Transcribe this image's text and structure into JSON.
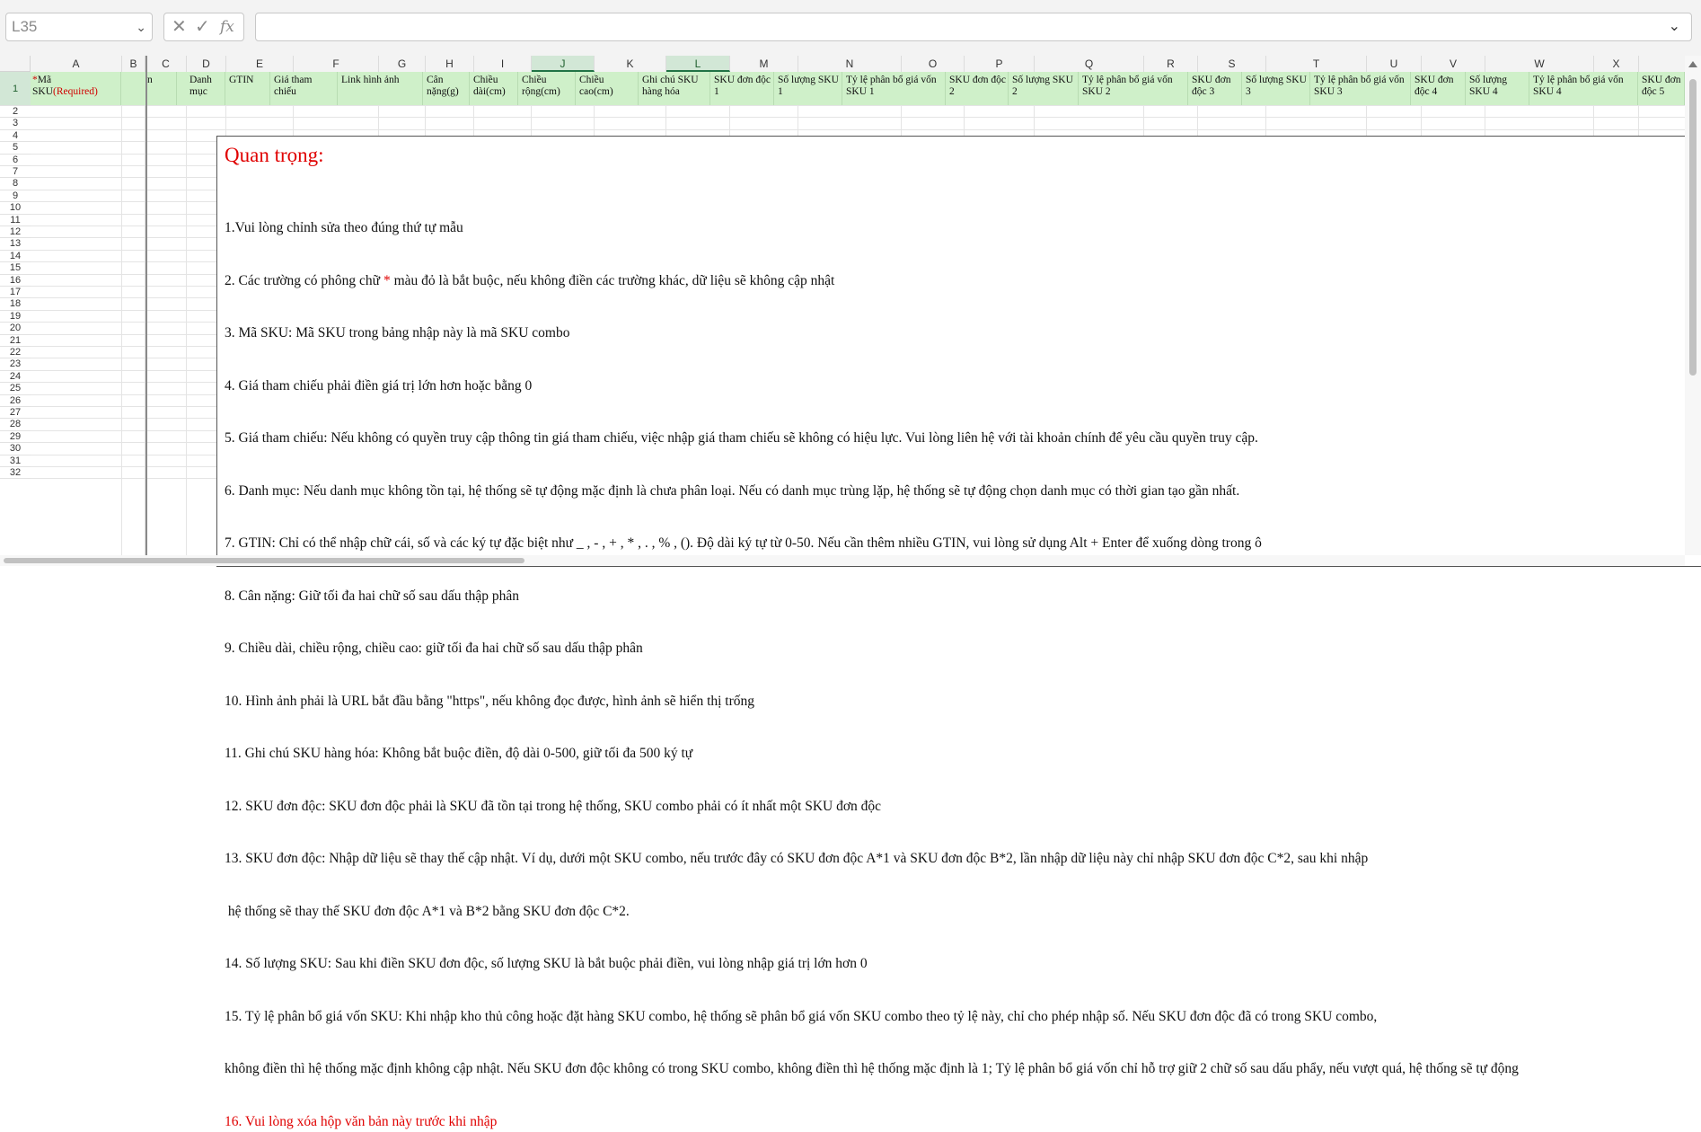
{
  "formula_bar": {
    "name_box": "L35",
    "cancel_glyph": "✕",
    "confirm_glyph": "✓",
    "fx_label": "fx",
    "formula_value": ""
  },
  "columns": [
    "A",
    "B",
    "C",
    "D",
    "E",
    "F",
    "G",
    "H",
    "I",
    "J",
    "K",
    "L",
    "M",
    "N",
    "O",
    "P",
    "Q",
    "R",
    "S",
    "T",
    "U",
    "V",
    "W",
    "X"
  ],
  "selected_columns": [
    "J",
    "L"
  ],
  "rows": [
    "1",
    "2",
    "3",
    "4",
    "5",
    "6",
    "7",
    "8",
    "9",
    "10",
    "11",
    "12",
    "13",
    "14",
    "15",
    "16",
    "17",
    "18",
    "19",
    "20",
    "21",
    "22",
    "23",
    "24",
    "25",
    "26",
    "27",
    "28",
    "29",
    "30",
    "31",
    "32"
  ],
  "header_row": {
    "A_star": "*",
    "A_text": "Mã SKU",
    "A_required": "(Required)",
    "B": "n",
    "C": "Danh mục",
    "D": "GTIN",
    "E": "Giá tham chiếu",
    "F": "Link hình ảnh",
    "G": "Cân nặng(g)",
    "H": "Chiều dài(cm)",
    "I": "Chiều rộng(cm)",
    "J": "Chiều cao(cm)",
    "K": "Ghi chú SKU hàng hóa",
    "L": "SKU đơn độc 1",
    "M": "Số lượng SKU 1",
    "N": "Tỷ lệ phân bổ giá vốn SKU 1",
    "O": "SKU đơn độc 2",
    "P": "Số lượng SKU 2",
    "Q": "Tỷ lệ phân bổ giá vốn SKU 2",
    "R": "SKU đơn độc 3",
    "S": "Số lượng SKU 3",
    "T": "Tỷ lệ phân bổ giá vốn SKU 3",
    "U": "SKU đơn độc 4",
    "V": "Số lượng SKU 4",
    "W": "Tỷ lệ phân bổ giá vốn SKU 4",
    "X": "SKU đơn độc 5"
  },
  "notice": {
    "title": "Quan trọng:",
    "line_1": "1.Vui lòng chỉnh sửa theo đúng thứ tự mẫu",
    "line_2a": "2. Các trường có phông chữ ",
    "line_2_star": "*",
    "line_2b": " màu đỏ là bắt buộc, nếu không điền các trường khác, dữ liệu sẽ không cập nhật",
    "line_3": "3. Mã SKU: Mã SKU trong bảng nhập này là mã SKU combo",
    "line_4": "4. Giá tham chiếu phải điền giá trị lớn hơn hoặc bằng 0",
    "line_5": "5. Giá tham chiếu: Nếu không có quyền truy cập thông tin giá tham chiếu, việc nhập giá tham chiếu sẽ không có hiệu lực. Vui lòng liên hệ với tài khoản chính để yêu cầu quyền truy cập.",
    "line_6": "6. Danh mục: Nếu danh mục không tồn tại, hệ thống sẽ tự động mặc định là chưa phân loại. Nếu có danh mục trùng lặp, hệ thống sẽ tự động chọn danh mục có thời gian tạo gần nhất.",
    "line_7": "7. GTIN: Chỉ có thể nhập chữ cái, số và các ký tự đặc biệt như _ , - , + , * , . , % , (). Độ dài ký tự từ 0-50. Nếu cần thêm nhiều GTIN, vui lòng sử dụng Alt + Enter để xuống dòng trong ô",
    "line_8": "8. Cân nặng: Giữ tối đa hai chữ số sau dấu thập phân",
    "line_9": "9. Chiều dài, chiều rộng, chiều cao: giữ tối đa hai chữ số sau dấu thập phân",
    "line_10": "10. Hình ảnh phải là URL bắt đầu bằng \"https\", nếu không đọc được, hình ảnh sẽ hiển thị trống",
    "line_11": "11. Ghi chú SKU hàng hóa: Không bắt buộc điền, độ dài 0-500, giữ tối đa 500 ký tự",
    "line_12": "12. SKU đơn độc: SKU đơn độc phải là SKU đã tồn tại trong hệ thống, SKU combo phải có ít nhất một SKU đơn độc",
    "line_13": "13. SKU đơn độc: Nhập dữ liệu sẽ thay thế cập nhật. Ví dụ, dưới một SKU combo, nếu trước đây có SKU đơn độc A*1 và SKU đơn độc B*2, lần nhập dữ liệu này chỉ nhập SKU đơn độc C*2, sau khi nhập",
    "line_13b": " hệ thống sẽ thay thế SKU đơn độc A*1 và B*2 bằng SKU đơn độc C*2.",
    "line_14": "14. Số lượng SKU: Sau khi điền SKU đơn độc, số lượng SKU là bắt buộc phải điền, vui lòng nhập giá trị lớn hơn 0",
    "line_15": "15. Tỷ lệ phân bổ giá vốn SKU: Khi nhập kho thủ công hoặc đặt hàng SKU combo, hệ thống sẽ phân bổ giá vốn SKU combo theo tỷ lệ này, chỉ cho phép nhập số. Nếu SKU đơn độc đã có trong SKU combo,",
    "line_15b": "không điền thì hệ thống mặc định không cập nhật. Nếu SKU đơn độc không có trong SKU combo, không điền thì hệ thống mặc định là 1; Tỷ lệ phân bổ giá vốn chỉ hỗ trợ giữ 2 chữ số sau dấu phẩy, nếu vượt quá, hệ thống sẽ tự động",
    "line_16": "16. Vui lòng xóa hộp văn bản này trước khi nhập"
  },
  "colors": {
    "header_fill": "#cff0c9",
    "selection_green": "#217346",
    "required_red": "#e00000"
  }
}
